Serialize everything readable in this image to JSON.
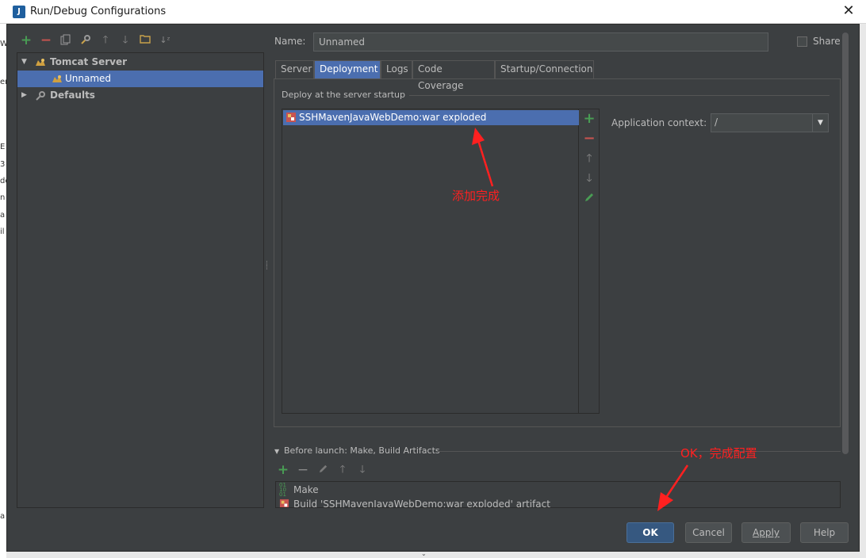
{
  "window": {
    "title": "Run/Debug Configurations",
    "app_icon_text": "J"
  },
  "background_fragments": [
    "W",
    "er",
    "E",
    "3",
    "de",
    "n",
    "a",
    "il",
    "a"
  ],
  "toolbar": {
    "icons": [
      "add-icon",
      "remove-icon",
      "copy-icon",
      "edit-defaults-icon",
      "move-up-icon",
      "move-down-icon",
      "folder-icon",
      "sort-icon"
    ]
  },
  "tree": {
    "items": [
      {
        "label": "Tomcat Server",
        "level": 0,
        "expanded": true,
        "selected": false
      },
      {
        "label": "Unnamed",
        "level": 1,
        "expanded": null,
        "selected": true
      },
      {
        "label": "Defaults",
        "level": 0,
        "expanded": false,
        "selected": false
      }
    ]
  },
  "form": {
    "name_label": "Name:",
    "name_value": "Unnamed",
    "share_label": "Share",
    "share_checked": false
  },
  "tabs": [
    {
      "label": "Server",
      "active": false
    },
    {
      "label": "Deployment",
      "active": true
    },
    {
      "label": "Logs",
      "active": false
    },
    {
      "label": "Code Coverage",
      "active": false
    },
    {
      "label": "Startup/Connection",
      "active": false
    }
  ],
  "deployment": {
    "section_label": "Deploy at the server startup",
    "artifacts": [
      "SSHMavenJavaWebDemo:war exploded"
    ],
    "side_tools": [
      "add-icon",
      "remove-icon",
      "move-up-icon",
      "move-down-icon",
      "edit-icon"
    ],
    "app_context_label": "Application context:",
    "app_context_value": "/"
  },
  "annotations": {
    "added": "添加完成",
    "ok_done": "OK，完成配置"
  },
  "before_launch": {
    "label": "Before launch: Make, Build Artifacts",
    "tools": [
      "add-icon",
      "remove-icon",
      "edit-icon",
      "move-up-icon",
      "move-down-icon"
    ],
    "items": [
      "Make",
      "Build 'SSHMavenJavaWebDemo:war exploded' artifact"
    ]
  },
  "buttons": {
    "ok": "OK",
    "cancel": "Cancel",
    "apply": "Apply",
    "help": "Help"
  },
  "colors": {
    "dialog_bg": "#3c3f41",
    "selection": "#4b6eaf",
    "annotation": "#ff2020",
    "add_green": "#499c54",
    "remove_red": "#c75450"
  }
}
